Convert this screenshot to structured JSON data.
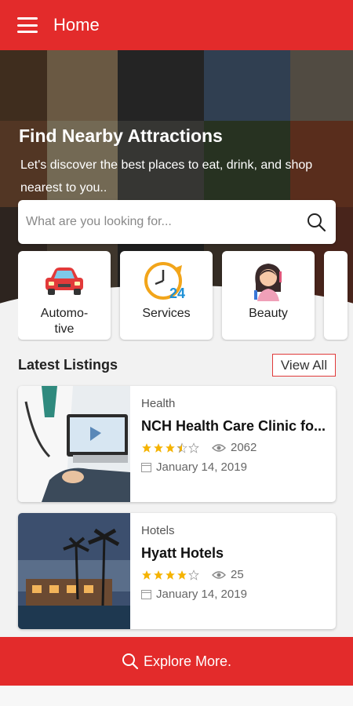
{
  "appbar": {
    "title": "Home",
    "menu_icon": "menu-icon"
  },
  "hero": {
    "title": "Find Nearby Attractions",
    "subtitle": "Let's discover the best places to eat, drink, and shop nearest to you..",
    "search_placeholder": "What are you looking for..."
  },
  "categories": [
    {
      "label": "Automo-tive",
      "icon": "car-icon"
    },
    {
      "label": "Services",
      "icon": "clock-24-icon"
    },
    {
      "label": "Beauty",
      "icon": "woman-icon"
    }
  ],
  "latest": {
    "title": "Latest Listings",
    "view_all": "View All"
  },
  "listings": [
    {
      "category": "Health",
      "title": "NCH Health Care Clinic fo...",
      "rating": 3.5,
      "views": "2062",
      "date": "January 14, 2019"
    },
    {
      "category": "Hotels",
      "title": "Hyatt Hotels",
      "rating": 4,
      "views": "25",
      "date": "January 14, 2019"
    }
  ],
  "explore": {
    "label": "Explore More."
  },
  "colors": {
    "primary": "#e32b2b",
    "star": "#f5b301"
  }
}
